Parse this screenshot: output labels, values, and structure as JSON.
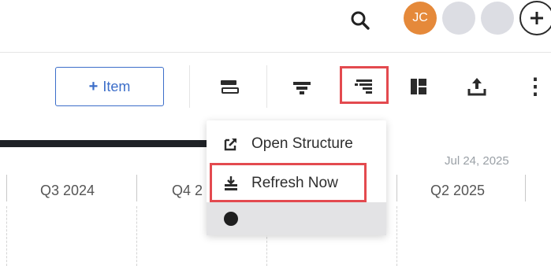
{
  "header": {
    "search_icon": "search-icon",
    "avatars": [
      {
        "initials": "JC",
        "color": "#e5893a"
      },
      {
        "initials": "",
        "color": "#dcdde3"
      },
      {
        "initials": "",
        "color": "#dcdde3"
      }
    ],
    "add_icon": "+"
  },
  "toolbar": {
    "item_button": {
      "plus": "+",
      "label": "Item"
    },
    "icons": [
      "gantt-bar-icon",
      "filter-icon",
      "structure-icon",
      "columns-icon",
      "export-icon",
      "more-icon"
    ],
    "more_glyph": "⋮"
  },
  "timeline": {
    "quarters": [
      "Q3 2024",
      "Q4 2",
      "Q2 2025"
    ],
    "date_marker": "Jul 24, 2025"
  },
  "menu": {
    "items": [
      {
        "label": "Open Structure",
        "icon": "open-external-icon"
      },
      {
        "label": "Refresh Now",
        "icon": "refresh-download-icon"
      }
    ]
  },
  "colors": {
    "accent": "#3c6ec9",
    "highlight": "#e34a4f",
    "avatar": "#e5893a"
  }
}
